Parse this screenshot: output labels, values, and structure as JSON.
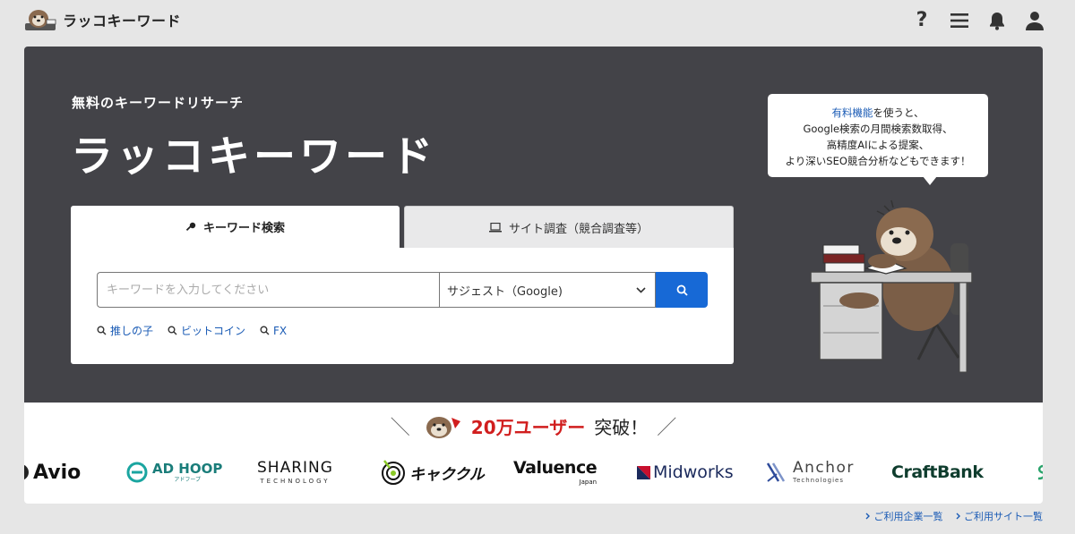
{
  "header": {
    "logo_text": "ラッコキーワード",
    "help_label": "?"
  },
  "hero": {
    "subtitle": "無料のキーワードリサーチ",
    "title": "ラッコキーワード",
    "tabs": [
      {
        "label": "キーワード検索",
        "active": true,
        "icon": "key-icon"
      },
      {
        "label": "サイト調査（競合調査等）",
        "active": false,
        "icon": "laptop-icon"
      }
    ],
    "search": {
      "placeholder": "キーワードを入力してください",
      "value": "",
      "engine_selected": "サジェスト（Google)"
    },
    "suggestions": [
      "推しの子",
      "ビットコイン",
      "FX"
    ]
  },
  "bubble": {
    "link": "有料機能",
    "line1_rest": "を使うと、",
    "line2": "Google検索の月間検索数取得、",
    "line3": "高精度AIによる提案、",
    "line4": "より深いSEO競合分析などもできます！"
  },
  "users": {
    "count": "20万ユーザー",
    "suffix": "突破！",
    "logos": [
      "Avio",
      "AD HOOP",
      "アドフープ",
      "SHARING",
      "TECHNOLOGY",
      "キャククル",
      "Valuence",
      "Japan",
      "Midworks",
      "Anchor",
      "Technologies",
      "CraftBank"
    ]
  },
  "footer": {
    "links": [
      "ご利用企業一覧",
      "ご利用サイト一覧"
    ]
  },
  "colors": {
    "accent": "#1769d6",
    "hero_bg": "#434348",
    "highlight": "#d11e1e"
  }
}
